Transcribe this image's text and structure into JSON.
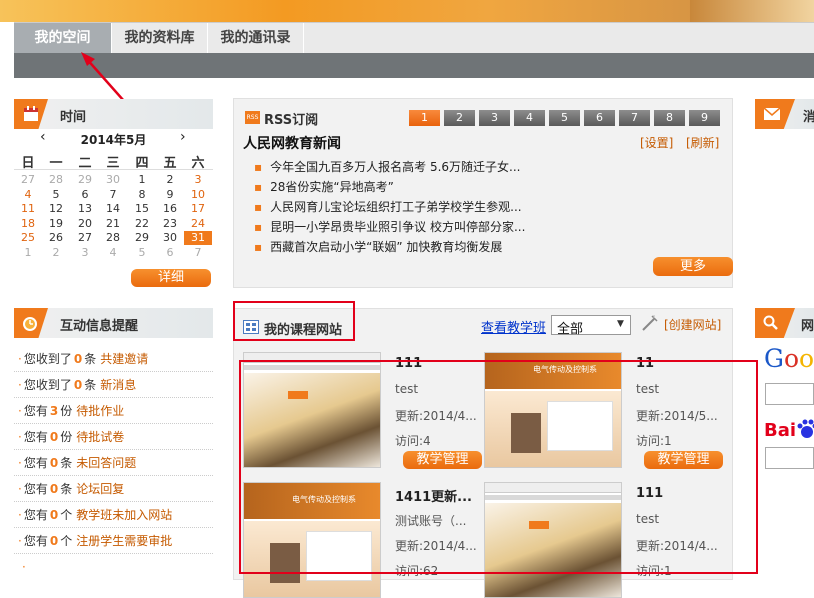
{
  "nav": {
    "tabs": [
      "我的空间",
      "我的资料库",
      "我的通讯录"
    ],
    "active": 0
  },
  "calendar": {
    "title": "时间",
    "month": "2014年5月",
    "prev": "‹",
    "next": "›",
    "weekdays": [
      "日",
      "一",
      "二",
      "三",
      "四",
      "五",
      "六"
    ],
    "weeks": [
      [
        "27",
        "28",
        "29",
        "30",
        "1",
        "2",
        "3"
      ],
      [
        "4",
        "5",
        "6",
        "7",
        "8",
        "9",
        "10"
      ],
      [
        "11",
        "12",
        "13",
        "14",
        "15",
        "16",
        "17"
      ],
      [
        "18",
        "19",
        "20",
        "21",
        "22",
        "23",
        "24"
      ],
      [
        "25",
        "26",
        "27",
        "28",
        "29",
        "30",
        "31"
      ],
      [
        "1",
        "2",
        "3",
        "4",
        "5",
        "6",
        "7"
      ]
    ],
    "today": "31",
    "detail_button": "详细"
  },
  "reminders": {
    "title": "互动信息提醒",
    "items": [
      {
        "pre": "您收到了",
        "count": "0",
        "mid": "条",
        "link": "共建邀请"
      },
      {
        "pre": "您收到了",
        "count": "0",
        "mid": "条",
        "link": "新消息"
      },
      {
        "pre": "您有",
        "count": "3",
        "mid": "份",
        "link": "待批作业"
      },
      {
        "pre": "您有",
        "count": "0",
        "mid": "份",
        "link": "待批试卷"
      },
      {
        "pre": "您有",
        "count": "0",
        "mid": "条",
        "link": "未回答问题"
      },
      {
        "pre": "您有",
        "count": "0",
        "mid": "条",
        "link": "论坛回复"
      },
      {
        "pre": "您有",
        "count": "0",
        "mid": "个",
        "link": "教学班未加入网站"
      },
      {
        "pre": "您有",
        "count": "0",
        "mid": "个",
        "link": "注册学生需要审批"
      }
    ]
  },
  "rss": {
    "title": "RSS订阅",
    "icon_text": "RSS",
    "pages": [
      "1",
      "2",
      "3",
      "4",
      "5",
      "6",
      "7",
      "8",
      "9"
    ],
    "active_page": "1",
    "feed_title": "人民网教育新闻",
    "settings_link": "[设置]",
    "refresh_link": "[刷新]",
    "news": [
      "今年全国九百多万人报名高考 5.6万随迁子女...",
      "28省份实施“异地高考”",
      "人民网育儿宝论坛组织打工子弟学校学生参观...",
      "昆明一小学昂贵毕业照引争议 校方叫停部分家...",
      "西藏首次启动小学“联姻” 加快教育均衡发展"
    ],
    "more_button": "更多"
  },
  "courses": {
    "title": "我的课程网站",
    "view_class_link": "查看教学班",
    "filter_value": "全部",
    "create_link": "[创建网站]",
    "items": [
      {
        "name": "111",
        "desc": "test",
        "updated": "更新:2014/4...",
        "visits": "访问:4",
        "button": "教学管理",
        "theme": "light"
      },
      {
        "name": "11",
        "desc": "test",
        "updated": "更新:2014/5...",
        "visits": "访问:1",
        "button": "教学管理",
        "theme": "orange"
      },
      {
        "name": "1411更新...",
        "desc": "测试账号（...",
        "updated": "更新:2014/4...",
        "visits": "访问:62",
        "button": "",
        "theme": "orange"
      },
      {
        "name": "111",
        "desc": "test",
        "updated": "更新:2014/4...",
        "visits": "访问:1",
        "button": "",
        "theme": "light"
      }
    ],
    "thumb_banner_text": "电气传动及控制系"
  },
  "right": {
    "msg_title": "消",
    "net_title": "网",
    "google": "Goog",
    "baidu": "Bai"
  },
  "colors": {
    "accent": "#f07a1c",
    "annotation": "#e2001a",
    "nav_active": "#a8adb1"
  }
}
